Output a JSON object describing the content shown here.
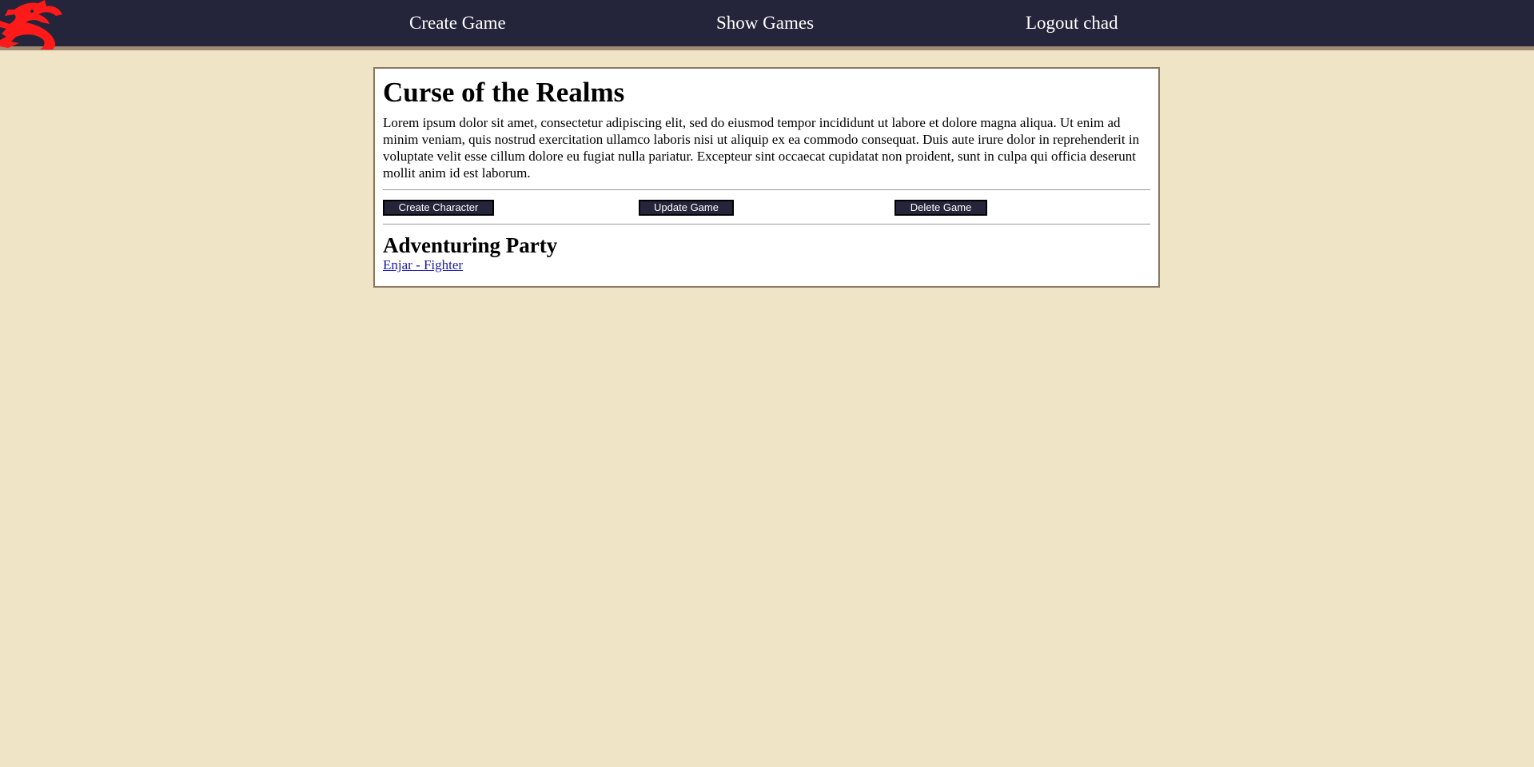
{
  "nav": {
    "logo_icon": "red-dragon-logo-icon",
    "links": [
      "Create Game",
      "Show Games",
      "Logout chad"
    ]
  },
  "game": {
    "title": "Curse of the Realms",
    "description": "Lorem ipsum dolor sit amet, consectetur adipiscing elit, sed do eiusmod tempor incididunt ut labore et dolore magna aliqua. Ut enim ad minim veniam, quis nostrud exercitation ullamco laboris nisi ut aliquip ex ea commodo consequat. Duis aute irure dolor in reprehenderit in voluptate velit esse cillum dolore eu fugiat nulla pariatur. Excepteur sint occaecat cupidatat non proident, sunt in culpa qui officia deserunt mollit anim id est laborum.",
    "buttons": {
      "create_character": "Create Character",
      "update_game": "Update Game",
      "delete_game": "Delete Game"
    }
  },
  "party": {
    "title": "Adventuring Party",
    "members": [
      "Enjar - Fighter"
    ]
  },
  "colors": {
    "nav_bg": "#24253a",
    "page_bg": "#efe4c6",
    "logo": "#ff1a1a",
    "link": "#1a1aa6"
  }
}
